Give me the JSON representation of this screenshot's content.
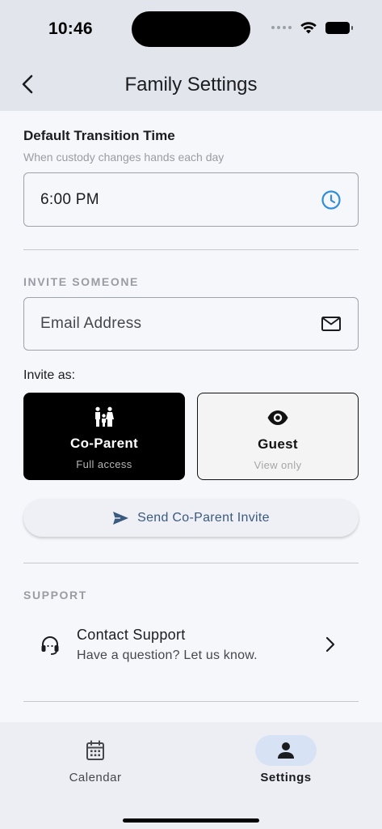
{
  "status_bar": {
    "time": "10:46"
  },
  "header": {
    "title": "Family Settings"
  },
  "transition": {
    "title": "Default Transition Time",
    "subtitle": "When custody changes hands each day",
    "time_value": "6:00 PM"
  },
  "invite": {
    "section_label": "INVITE SOMEONE",
    "email_placeholder": "Email Address",
    "email_value": "",
    "invite_as_label": "Invite as:",
    "roles": [
      {
        "name": "Co-Parent",
        "description": "Full access",
        "selected": true
      },
      {
        "name": "Guest",
        "description": "View only",
        "selected": false
      }
    ],
    "send_label": "Send Co-Parent Invite"
  },
  "support": {
    "section_label": "SUPPORT",
    "contact_title": "Contact Support",
    "contact_subtitle": "Have a question? Let us know."
  },
  "bottom_nav": {
    "items": [
      {
        "label": "Calendar",
        "icon": "calendar-icon",
        "active": false
      },
      {
        "label": "Settings",
        "icon": "person-icon",
        "active": true
      }
    ]
  },
  "colors": {
    "accent_blue": "#2f8fd8",
    "send_text": "#3a5a7e",
    "active_nav_pill": "#d7e3f4",
    "selected_card": "#000000"
  }
}
